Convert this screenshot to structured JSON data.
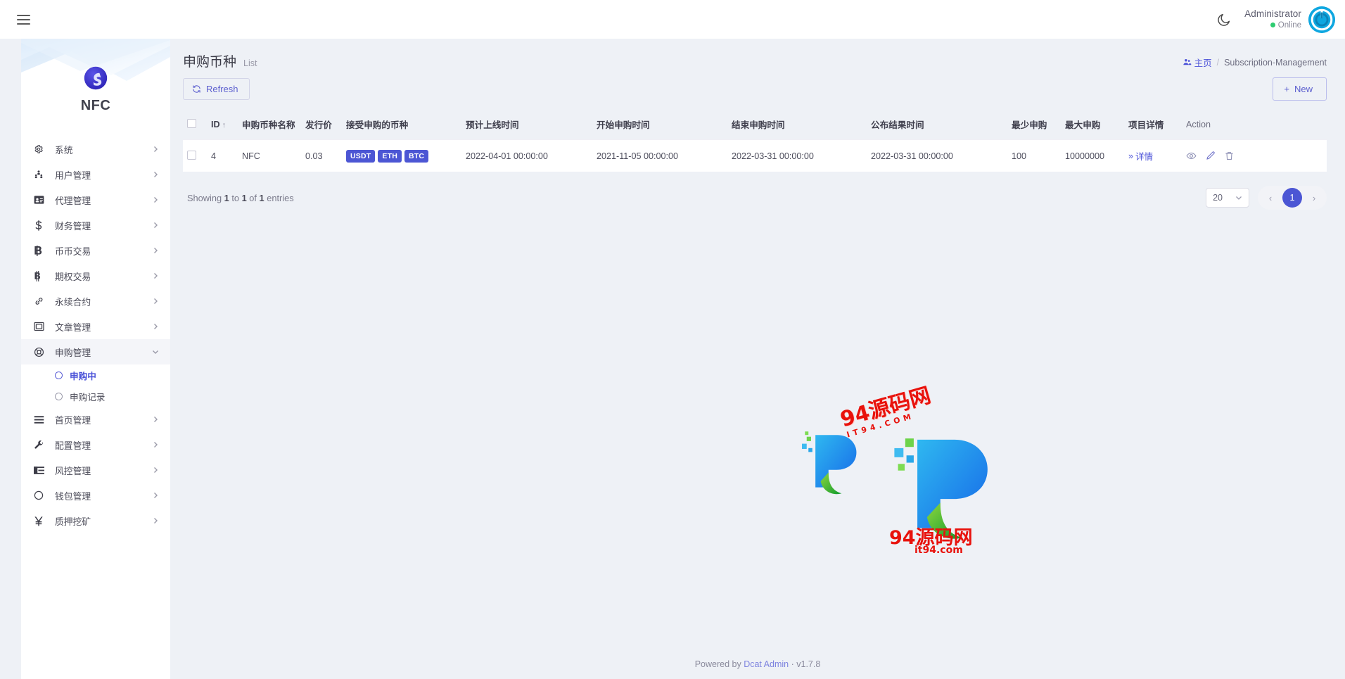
{
  "navbar": {
    "menu_toggle": "hamburger-menu",
    "theme_toggle_icon": "moon-icon",
    "user_name": "Administrator",
    "user_status": "Online"
  },
  "sidebar": {
    "brand_name": "NFC",
    "items": [
      {
        "label": "系统",
        "icon": "gear-icon",
        "has_children": true,
        "active": false
      },
      {
        "label": "用户管理",
        "icon": "users-icon",
        "has_children": true,
        "active": false
      },
      {
        "label": "代理管理",
        "icon": "id-card-icon",
        "has_children": true,
        "active": false
      },
      {
        "label": "财务管理",
        "icon": "dollar-icon",
        "has_children": true,
        "active": false
      },
      {
        "label": "币币交易",
        "icon": "bold-b-icon",
        "has_children": true,
        "active": false
      },
      {
        "label": "期权交易",
        "icon": "bitcoin-icon",
        "has_children": true,
        "active": false
      },
      {
        "label": "永续合约",
        "icon": "link-icon",
        "has_children": true,
        "active": false
      },
      {
        "label": "文章管理",
        "icon": "image-icon",
        "has_children": true,
        "active": false
      },
      {
        "label": "申购管理",
        "icon": "lifebuoy-icon",
        "has_children": true,
        "active": true
      },
      {
        "label": "首页管理",
        "icon": "bars-icon",
        "has_children": true,
        "active": false
      },
      {
        "label": "配置管理",
        "icon": "wrench-icon",
        "has_children": true,
        "active": false
      },
      {
        "label": "风控管理",
        "icon": "list-indent-icon",
        "has_children": true,
        "active": false
      },
      {
        "label": "钱包管理",
        "icon": "circle-icon",
        "has_children": true,
        "active": false
      },
      {
        "label": "质押挖矿",
        "icon": "yen-icon",
        "has_children": true,
        "active": false
      }
    ],
    "submenu": [
      {
        "label": "申购中",
        "active": true
      },
      {
        "label": "申购记录",
        "active": false
      }
    ]
  },
  "page": {
    "title": "申购币种",
    "subtitle": "List",
    "breadcrumb_home": "主页",
    "breadcrumb_sep": "/",
    "breadcrumb_current": "Subscription-Management"
  },
  "toolbar": {
    "refresh_label": "Refresh",
    "new_label": "New",
    "new_plus": "+"
  },
  "table": {
    "columns": [
      {
        "key": "checkbox",
        "label": ""
      },
      {
        "key": "id",
        "label": "ID",
        "sorted": "asc"
      },
      {
        "key": "name",
        "label": "申购币种名称"
      },
      {
        "key": "price",
        "label": "发行价"
      },
      {
        "key": "accepted",
        "label": "接受申购的币种"
      },
      {
        "key": "online_time",
        "label": "预计上线时间"
      },
      {
        "key": "start_time",
        "label": "开始申购时间"
      },
      {
        "key": "end_time",
        "label": "结束申购时间"
      },
      {
        "key": "result_time",
        "label": "公布结果时间"
      },
      {
        "key": "min",
        "label": "最少申购"
      },
      {
        "key": "max",
        "label": "最大申购"
      },
      {
        "key": "detail",
        "label": "项目详情"
      },
      {
        "key": "action",
        "label": "Action"
      }
    ],
    "sort_indicator": "↑",
    "rows": [
      {
        "id": "4",
        "name": "NFC",
        "price": "0.03",
        "accepted": [
          "USDT",
          "ETH",
          "BTC"
        ],
        "online_time": "2022-04-01 00:00:00",
        "start_time": "2021-11-05 00:00:00",
        "end_time": "2022-03-31 00:00:00",
        "result_time": "2022-03-31 00:00:00",
        "min": "100",
        "max": "10000000",
        "detail_label": "详情",
        "detail_prefix": "»"
      }
    ]
  },
  "footer_bar": {
    "showing_prefix": "Showing",
    "showing_from": "1",
    "showing_mid": "to",
    "showing_to": "1",
    "showing_of": "of",
    "showing_total": "1",
    "showing_suffix": "entries",
    "per_page": "20",
    "prev_label": "‹",
    "next_label": "›",
    "current_page": "1"
  },
  "watermark": {
    "line1": "94源码网",
    "line2": "IT94.COM",
    "line3": "94源码网",
    "line4": "it94.com"
  },
  "footer": {
    "powered_prefix": "Powered by",
    "brand": "Dcat Admin",
    "dot": "·",
    "version": "v1.7.8"
  },
  "colors": {
    "accent": "#4c56d4",
    "link": "#4a51d8",
    "online": "#2ecc71",
    "watermark_red": "#e8120c",
    "page_bg": "#eef1f6"
  }
}
